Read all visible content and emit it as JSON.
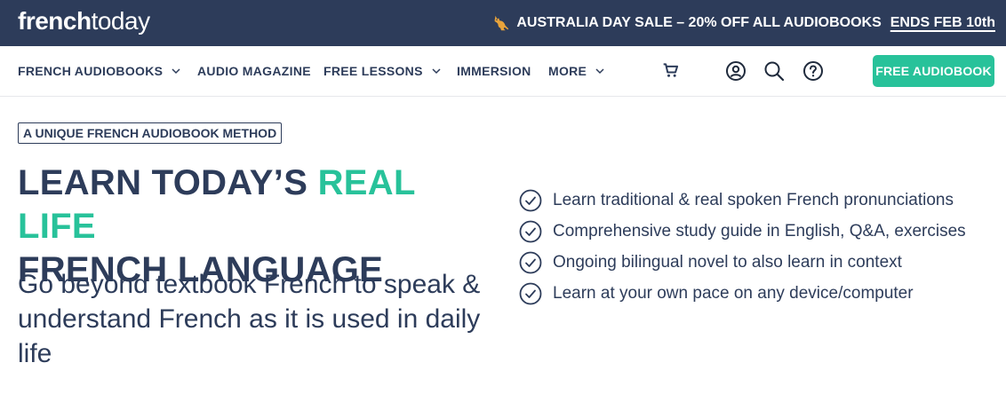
{
  "header": {
    "logo_bold": "french",
    "logo_light": "today",
    "promo_icon": "kangaroo-icon",
    "promo_text": "AUSTRALIA DAY SALE – 20% OFF ALL AUDIOBOOKS",
    "promo_link": "ENDS FEB 10th"
  },
  "nav": {
    "items": [
      {
        "label": "FRENCH AUDIOBOOKS",
        "has_dropdown": true
      },
      {
        "label": "AUDIO MAGAZINE",
        "has_dropdown": false
      },
      {
        "label": "FREE LESSONS",
        "has_dropdown": true
      },
      {
        "label": "IMMERSION",
        "has_dropdown": false
      },
      {
        "label": "MORE",
        "has_dropdown": true
      }
    ],
    "icons": [
      "cart-icon",
      "account-icon",
      "search-icon",
      "help-icon"
    ],
    "cta_label": "FREE AUDIOBOOK"
  },
  "hero": {
    "badge": "A UNIQUE FRENCH AUDIOBOOK METHOD",
    "headline_part1": "LEARN TODAY’S ",
    "headline_accent": "REAL LIFE",
    "headline_part2": "FRENCH LANGUAGE",
    "subheadline": "Go beyond textbook French to speak & understand French as it is used in daily life"
  },
  "benefits": [
    "Learn traditional & real spoken French pronunciations",
    "Comprehensive study guide in English, Q&A, exercises",
    "Ongoing bilingual novel to also learn in context",
    "Learn at your own pace on any device/computer"
  ],
  "colors": {
    "navy": "#2d3c5a",
    "accent_green": "#28c29a",
    "white": "#ffffff"
  }
}
